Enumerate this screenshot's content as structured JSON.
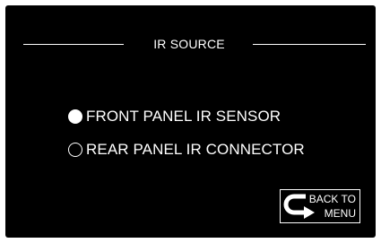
{
  "header": {
    "title": "IR SOURCE"
  },
  "options": [
    {
      "label": "FRONT PANEL IR SENSOR",
      "selected": true
    },
    {
      "label": "REAR PANEL IR CONNECTOR",
      "selected": false
    }
  ],
  "back_button": {
    "line1": "BACK TO",
    "line2": "MENU",
    "icon": "return-arrow-icon"
  },
  "colors": {
    "background": "#000000",
    "foreground": "#ffffff"
  }
}
